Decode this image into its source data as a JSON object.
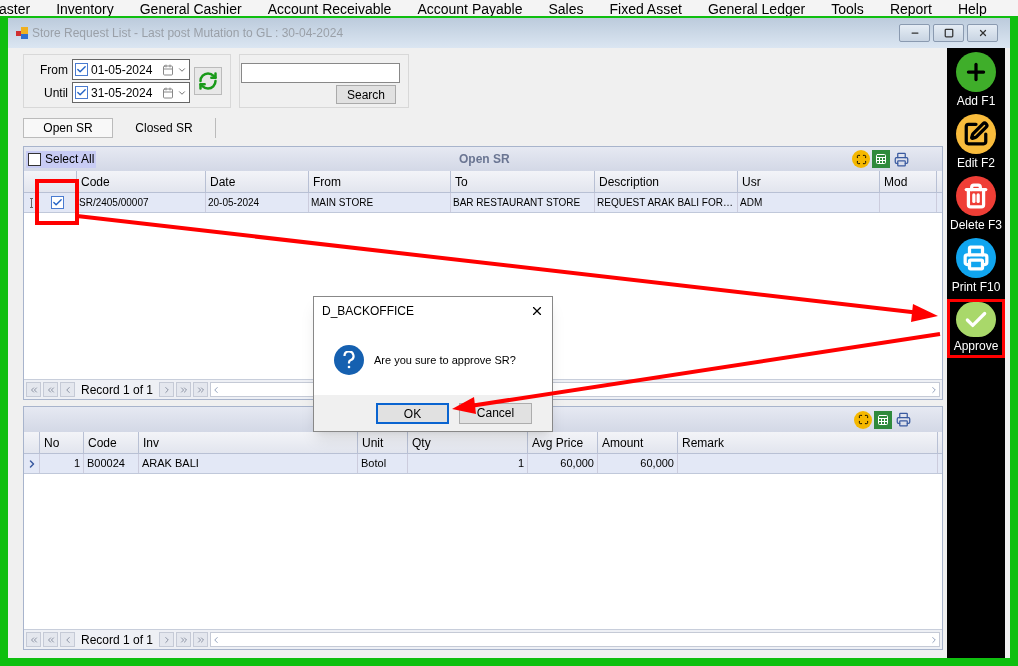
{
  "menu": [
    "aster",
    "Inventory",
    "General Cashier",
    "Account Receivable",
    "Account Payable",
    "Sales",
    "Fixed Asset",
    "General Ledger",
    "Tools",
    "Report",
    "Help"
  ],
  "window": {
    "title": "Store Request List - Last post Mutation to GL : 30-04-2024"
  },
  "filter": {
    "dates": [
      {
        "label": "From",
        "checked": true,
        "value": "01-05-2024"
      },
      {
        "label": "Until",
        "checked": true,
        "value": "31-05-2024"
      }
    ],
    "search_button": "Search"
  },
  "tabs": [
    {
      "label": "Open SR",
      "selected": true
    },
    {
      "label": "Closed SR",
      "selected": false
    }
  ],
  "upper_grid": {
    "select_all": {
      "label": "Select All",
      "checked": false
    },
    "title": "Open SR",
    "columns": [
      "Code",
      "Date",
      "From",
      "To",
      "Description",
      "Usr",
      "Mod"
    ],
    "rows": [
      {
        "checked": true,
        "selected": true,
        "cells": [
          "SR/2405/00007",
          "20-05-2024",
          "MAIN STORE",
          "BAR RESTAURANT STORE",
          "REQUEST ARAK BALI FOR…",
          "ADM"
        ]
      }
    ],
    "pager": "Record 1 of 1"
  },
  "lower_grid": {
    "columns": [
      "No",
      "Code",
      "Inv",
      "Unit",
      "Qty",
      "Avg Price",
      "Amount",
      "Remark"
    ],
    "rows": [
      {
        "selected": true,
        "cells": [
          "1",
          "B00024",
          "ARAK BALI",
          "Botol",
          "1",
          "60,000",
          "60,000"
        ]
      }
    ],
    "pager": "Record 1 of 1"
  },
  "toolbar": [
    {
      "label": "Add F1",
      "kind": "add",
      "highlighted": false
    },
    {
      "label": "Edit F2",
      "kind": "edit",
      "highlighted": false
    },
    {
      "label": "Delete F3",
      "kind": "delete",
      "highlighted": false
    },
    {
      "label": "Print F10",
      "kind": "print",
      "highlighted": false
    },
    {
      "label": "Approve",
      "kind": "approve",
      "highlighted": true
    }
  ],
  "dialog": {
    "title": "D_BACKOFFICE",
    "message": "Are you sure to approve SR?",
    "buttons": [
      {
        "label": "OK",
        "selected": true
      },
      {
        "label": "Cancel",
        "selected": false
      }
    ]
  }
}
